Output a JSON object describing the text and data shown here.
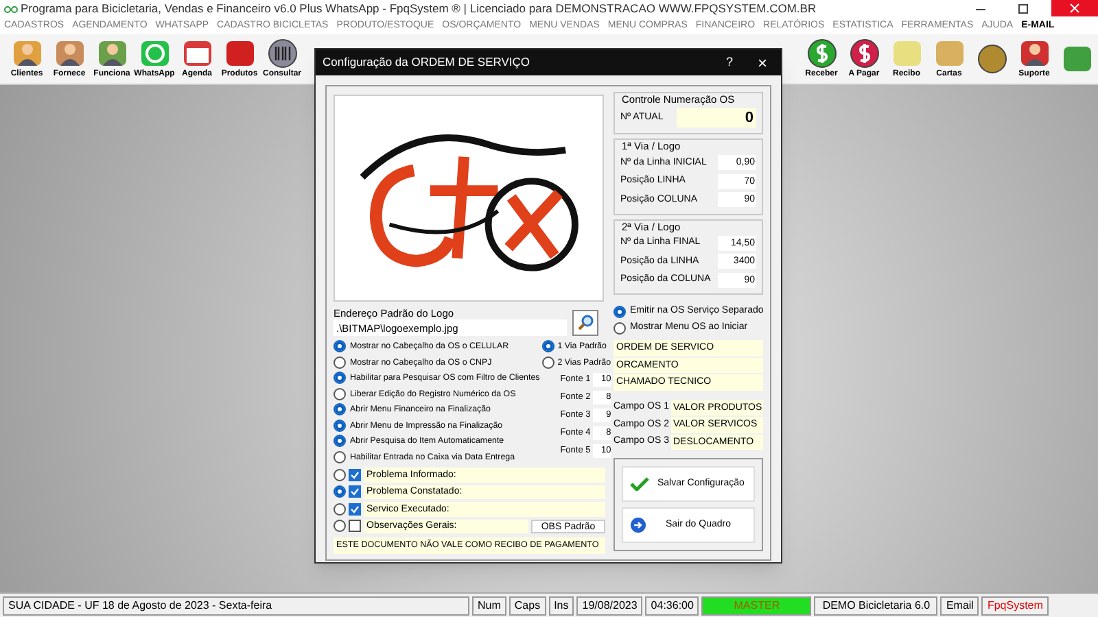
{
  "title_bar": {
    "title": "Programa para Bicicletaria, Vendas e Financeiro v6.0 Plus WhatsApp - FpqSystem ® | Licenciado para  DEMONSTRACAO WWW.FPQSYSTEM.COM.BR"
  },
  "menu": [
    "CADASTROS",
    "AGENDAMENTO",
    "WHATSAPP",
    "CADASTRO BICICLETAS",
    "PRODUTO/ESTOQUE",
    "OS/ORÇAMENTO",
    "MENU VENDAS",
    "MENU COMPRAS",
    "FINANCEIRO",
    "RELATÓRIOS",
    "ESTATISTICA",
    "FERRAMENTAS",
    "AJUDA",
    "E-MAIL"
  ],
  "toolbar_left": [
    {
      "label": "Clientes"
    },
    {
      "label": "Fornece"
    },
    {
      "label": "Funciona"
    },
    {
      "label": "WhatsApp"
    },
    {
      "label": "Agenda"
    },
    {
      "label": "Produtos"
    },
    {
      "label": "Consultar"
    }
  ],
  "toolbar_right": [
    {
      "label": "Receber"
    },
    {
      "label": "A Pagar"
    },
    {
      "label": "Recibo"
    },
    {
      "label": "Cartas"
    }
  ],
  "toolbar_end": [
    {
      "label": "Suporte"
    }
  ],
  "dialog": {
    "title": "Configuração da ORDEM DE SERVIÇO",
    "help": "?",
    "close": "×",
    "logo_label": "Endereço Padrão do Logo",
    "logo_path": ".\\BITMAP\\logoexemplo.jpg",
    "options": [
      {
        "label": "Mostrar no Cabeçalho da OS o CELULAR",
        "checked": true
      },
      {
        "label": "Mostrar no Cabeçalho da OS o CNPJ",
        "checked": false
      },
      {
        "label": "Habilitar para Pesquisar OS com Filtro de Clientes",
        "checked": true
      },
      {
        "label": "Liberar Edição do Registro Numérico da OS",
        "checked": false
      },
      {
        "label": "Abrir Menu Financeiro na Finalização",
        "checked": true
      },
      {
        "label": "Abrir Menu de Impressão na Finalização",
        "checked": true
      },
      {
        "label": "Abrir Pesquisa do Item Automaticamente",
        "checked": true
      },
      {
        "label": "Habilitar Entrada no Caixa via Data Entrega",
        "checked": false
      }
    ],
    "vias": [
      {
        "label": "1 Via Padrão",
        "selected": true
      },
      {
        "label": "2 Vias Padrão",
        "selected": false
      }
    ],
    "fonts": [
      {
        "label": "Fonte 1",
        "value": "10"
      },
      {
        "label": "Fonte 2",
        "value": "8"
      },
      {
        "label": "Fonte 3",
        "value": "9"
      },
      {
        "label": "Fonte 4",
        "value": "8"
      },
      {
        "label": "Fonte 5",
        "value": "10"
      }
    ],
    "text_fields": [
      {
        "selected": false,
        "checked": true,
        "value": "Problema Informado:"
      },
      {
        "selected": true,
        "checked": true,
        "value": "Problema Constatado:"
      },
      {
        "selected": false,
        "checked": true,
        "value": "Servico Executado:"
      },
      {
        "selected": false,
        "checked": false,
        "value": "Observações Gerais:",
        "button": "OBS Padrão"
      }
    ],
    "footer_text": "ESTE DOCUMENTO NÃO VALE COMO RECIBO DE PAGAMENTO",
    "numbering": {
      "title": "Controle Numeração OS",
      "label": "Nº ATUAL",
      "value": "0"
    },
    "via_groups": [
      {
        "title": "1ª Via / Logo",
        "fields": [
          {
            "label": "Nº da Linha INICIAL",
            "value": "0,90"
          },
          {
            "label": "Posição LINHA",
            "value": "70"
          },
          {
            "label": "Posição COLUNA",
            "value": "90"
          }
        ]
      },
      {
        "title": "2ª Via / Logo",
        "fields": [
          {
            "label": "Nº da Linha FINAL",
            "value": "14,50"
          },
          {
            "label": "Posição da LINHA",
            "value": "3400"
          },
          {
            "label": "Posição da COLUNA",
            "value": "90"
          }
        ]
      }
    ],
    "right_options": [
      {
        "label": "Emitir na OS Serviço Separado",
        "checked": true
      },
      {
        "label": "Mostrar Menu OS ao Iniciar",
        "checked": false
      }
    ],
    "titles": [
      "ORDEM DE SERVICO",
      "ORCAMENTO",
      "CHAMADO TECNICO"
    ],
    "campos": [
      {
        "label": "Campo OS 1",
        "value": "VALOR PRODUTOS"
      },
      {
        "label": "Campo OS 2",
        "value": "VALOR SERVICOS"
      },
      {
        "label": "Campo OS 3",
        "value": "DESLOCAMENTO"
      }
    ],
    "buttons": [
      {
        "label": "Salvar Configuração",
        "kind": "save"
      },
      {
        "label": "Sair do Quadro",
        "kind": "exit"
      }
    ]
  },
  "status_bar": [
    {
      "text": "SUA CIDADE - UF 18 de Agosto de 2023 - Sexta-feira",
      "kind": "text"
    },
    {
      "text": "Num",
      "kind": "text"
    },
    {
      "text": "Caps",
      "kind": "text"
    },
    {
      "text": "Ins",
      "kind": "text"
    },
    {
      "text": "19/08/2023",
      "kind": "text"
    },
    {
      "text": "04:36:00",
      "kind": "text"
    },
    {
      "text": "MASTER",
      "kind": "user"
    },
    {
      "text": "DEMO Bicicletaria 6.0",
      "kind": "version"
    },
    {
      "text": "Email",
      "kind": "email"
    },
    {
      "text": "FpqSystem",
      "kind": "brand"
    }
  ]
}
